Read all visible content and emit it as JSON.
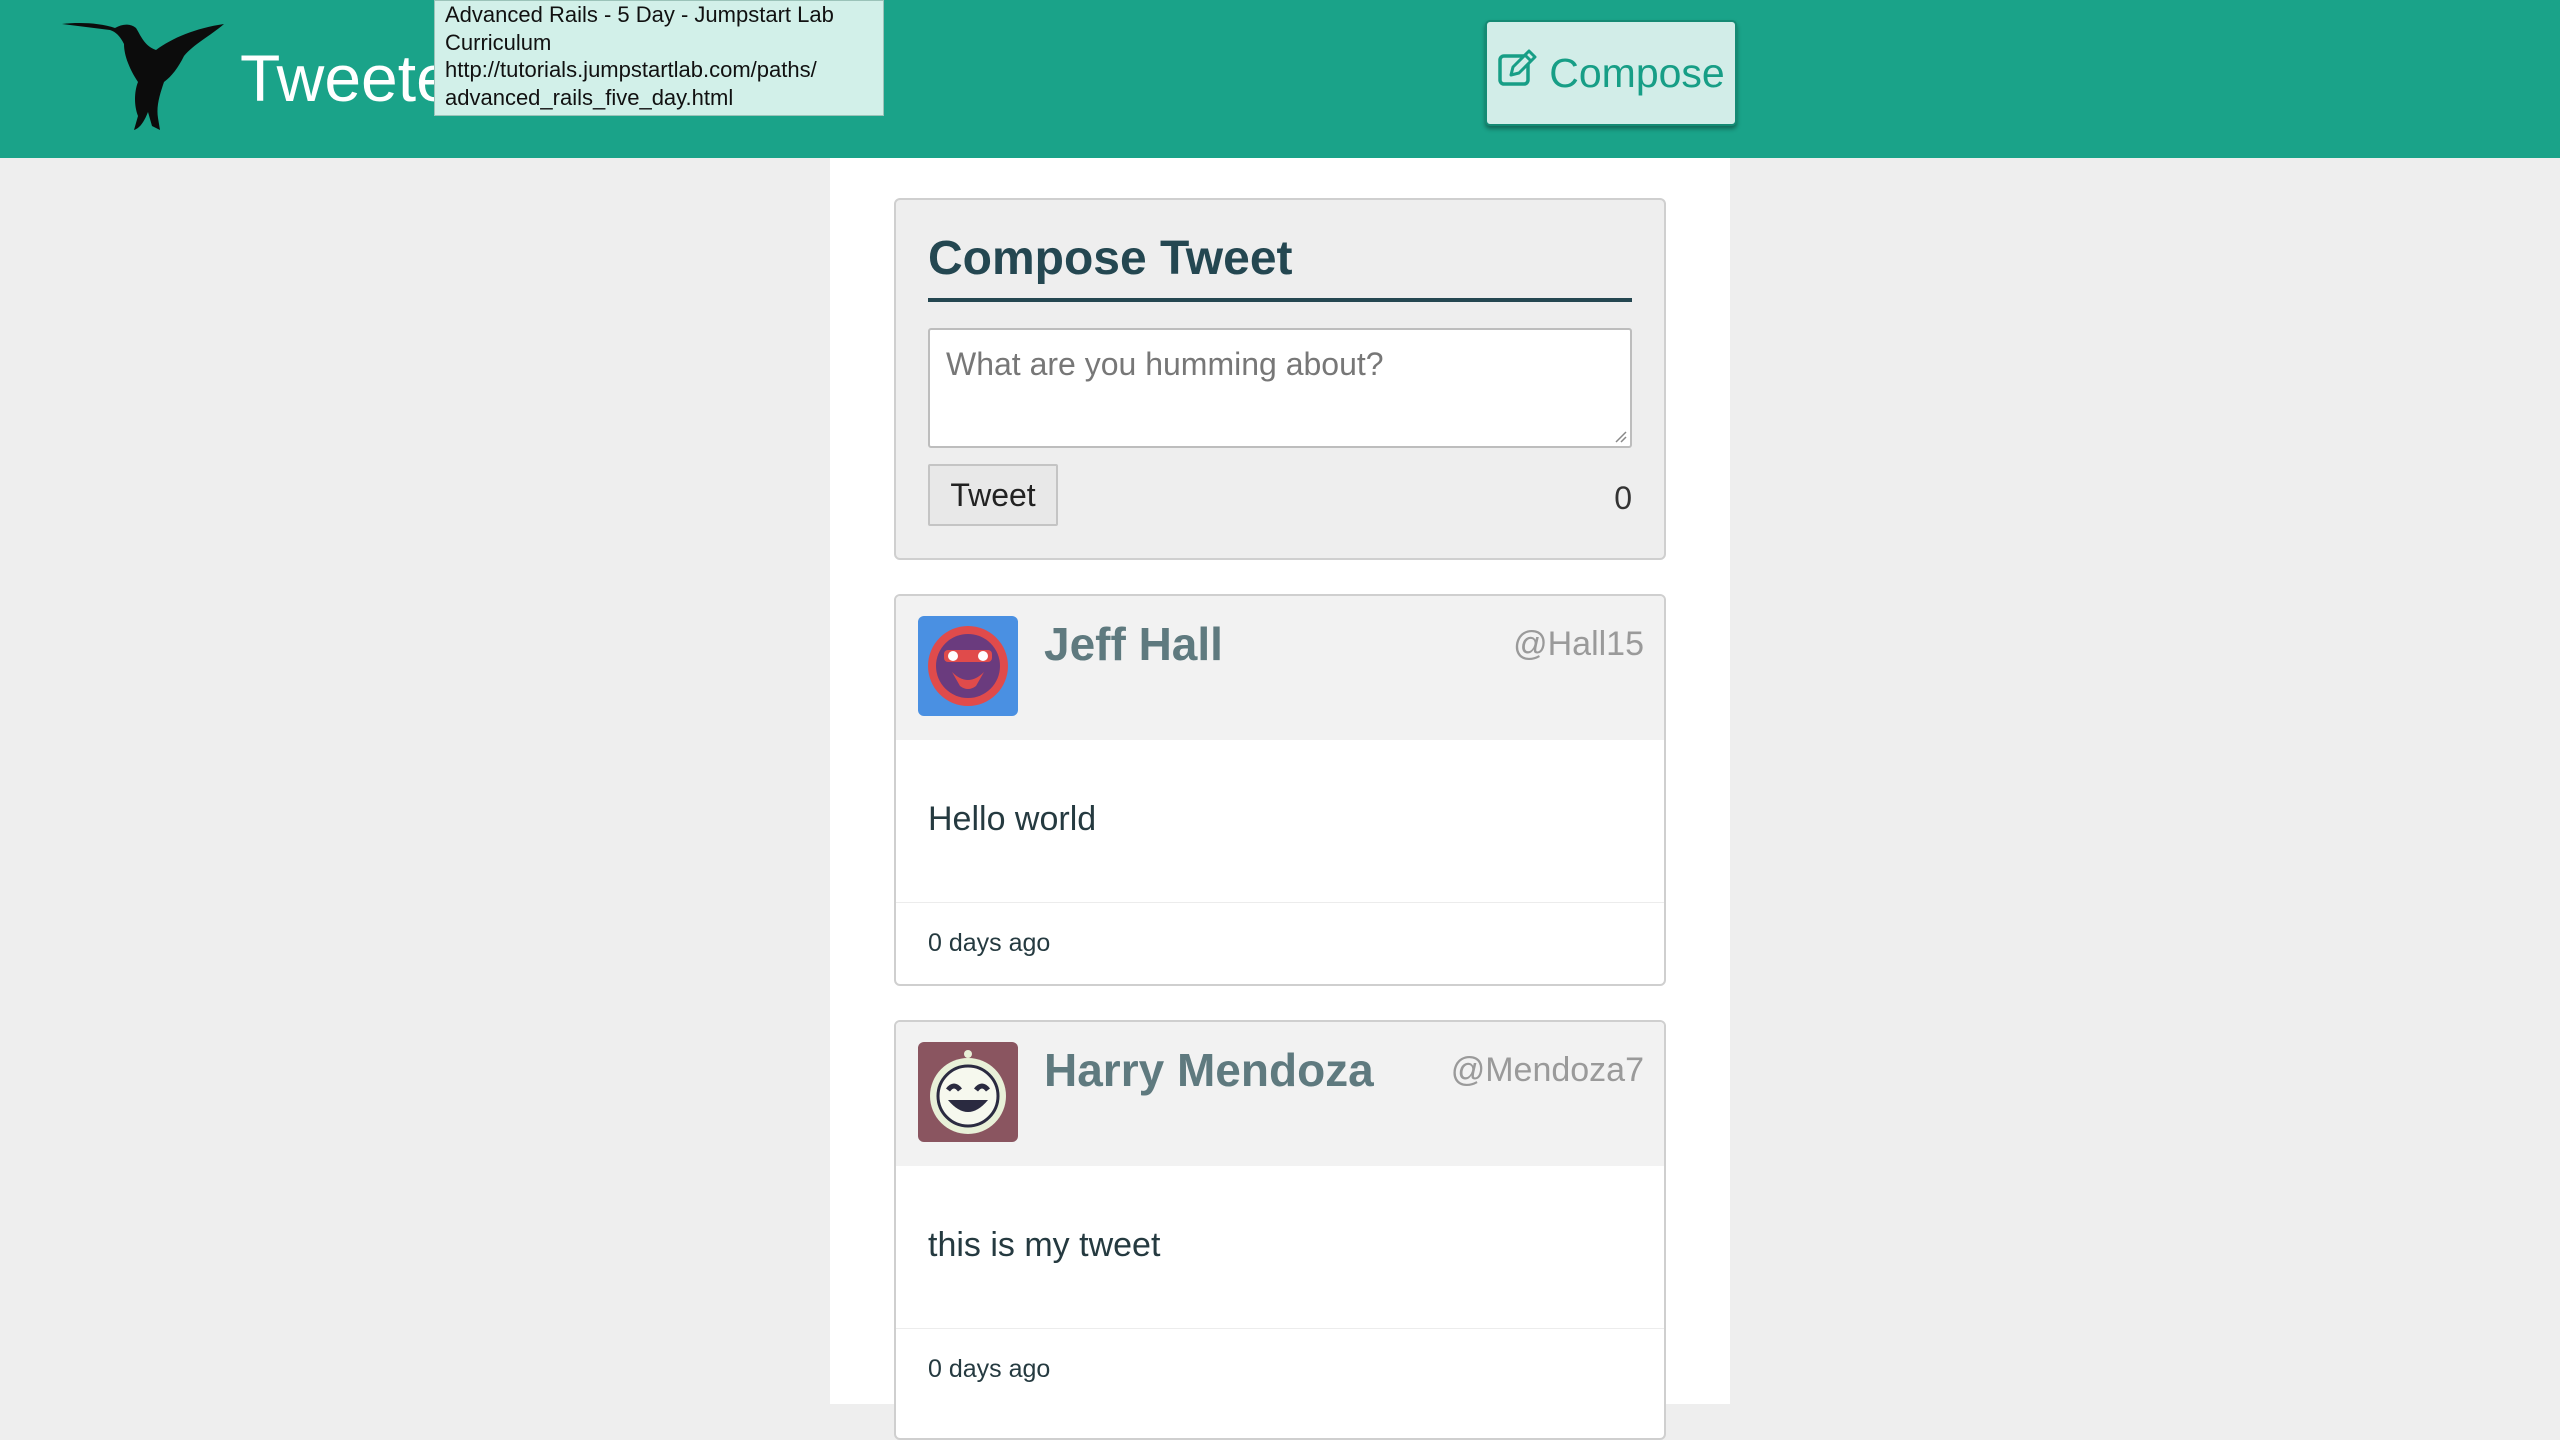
{
  "navbar": {
    "brand": "Tweeter",
    "compose_button_label": "Compose",
    "compose_icon": "pencil-square-icon",
    "logo_icon": "hummingbird-icon",
    "background_color": "#1aa389"
  },
  "tooltip": {
    "lines": [
      "Advanced Rails - 5 Day - Jumpstart Lab",
      "Curriculum",
      "http://tutorials.jumpstartlab.com/paths/",
      "advanced_rails_five_day.html"
    ]
  },
  "compose": {
    "title": "Compose Tweet",
    "placeholder": "What are you humming about?",
    "submit_label": "Tweet",
    "char_count": "0"
  },
  "tweets": [
    {
      "name": "Jeff Hall",
      "handle": "@Hall15",
      "text": "Hello world",
      "time": "0 days ago",
      "avatar_icon": "robot-face-avatar-icon",
      "avatar_color": "#4a90e2"
    },
    {
      "name": "Harry Mendoza",
      "handle": "@Mendoza7",
      "text": "this is my tweet",
      "time": "0 days ago",
      "avatar_icon": "smiling-robot-avatar-icon",
      "avatar_color": "#8a5560"
    }
  ]
}
